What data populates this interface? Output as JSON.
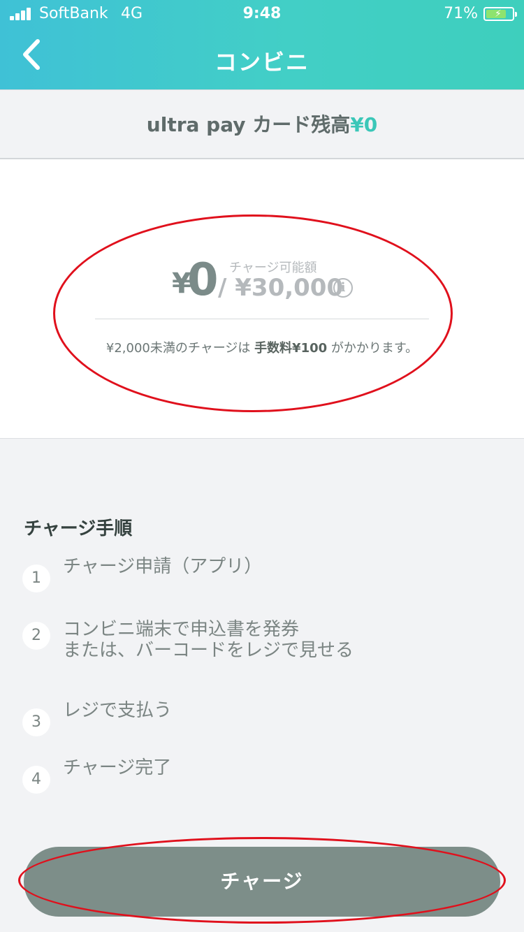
{
  "status_bar": {
    "carrier": "SoftBank",
    "network": "4G",
    "time": "9:48",
    "battery_percent": "71%",
    "battery_level": 0.71
  },
  "nav": {
    "title": "コンビニ",
    "back_icon": "chevron-left-icon"
  },
  "balance": {
    "label": "ultra pay カード残高",
    "amount": "¥0"
  },
  "charge_amount": {
    "currency": "¥",
    "value": "0",
    "limit_label": "チャージ可能額",
    "limit_value": "/ ¥30,000",
    "info_icon": "i"
  },
  "fee_note": {
    "prefix": "¥2,000未満のチャージは ",
    "emphasis": "手数料¥100",
    "suffix": " がかかります。"
  },
  "steps": {
    "title": "チャージ手順",
    "items": [
      {
        "num": "1",
        "text": "チャージ申請（アプリ）"
      },
      {
        "num": "2",
        "text": "コンビニ端末で申込書を発券\nまたは、バーコードをレジで見せる"
      },
      {
        "num": "3",
        "text": "レジで支払う"
      },
      {
        "num": "4",
        "text": "チャージ完了"
      }
    ]
  },
  "charge_button": {
    "label": "チャージ"
  },
  "colors": {
    "header_start": "#3fc1d6",
    "header_end": "#3ecfbd",
    "accent": "#3bc7b8",
    "button": "#7d8e89",
    "annotation": "#e0101c"
  }
}
